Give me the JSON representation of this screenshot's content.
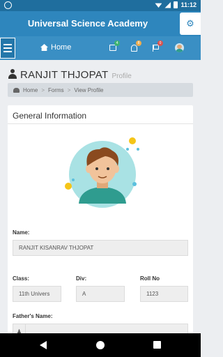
{
  "status_bar": {
    "time": "11:12"
  },
  "app": {
    "title": "Universal Science Academy"
  },
  "nav": {
    "home_label": "Home",
    "mail_count": "4",
    "bell_count": "8",
    "flag_count": "0"
  },
  "page": {
    "name": "RANJIT  THJOPAT",
    "subtitle": "Profile"
  },
  "breadcrumb": [
    "Home",
    "Forms",
    "View Profile"
  ],
  "card": {
    "title": "General Information",
    "name_label": "Name:",
    "name_value": "RANJIT  KISANRAV THJOPAT",
    "class_label": "Class:",
    "class_value": "11th Univers",
    "div_label": "Div:",
    "div_value": "A",
    "roll_label": "Roll No",
    "roll_value": "1123",
    "father_label": "Father's Name:"
  },
  "colors": {
    "primary": "#2e86bd",
    "nav": "#3a8fc4",
    "status": "#1f6e9e"
  }
}
